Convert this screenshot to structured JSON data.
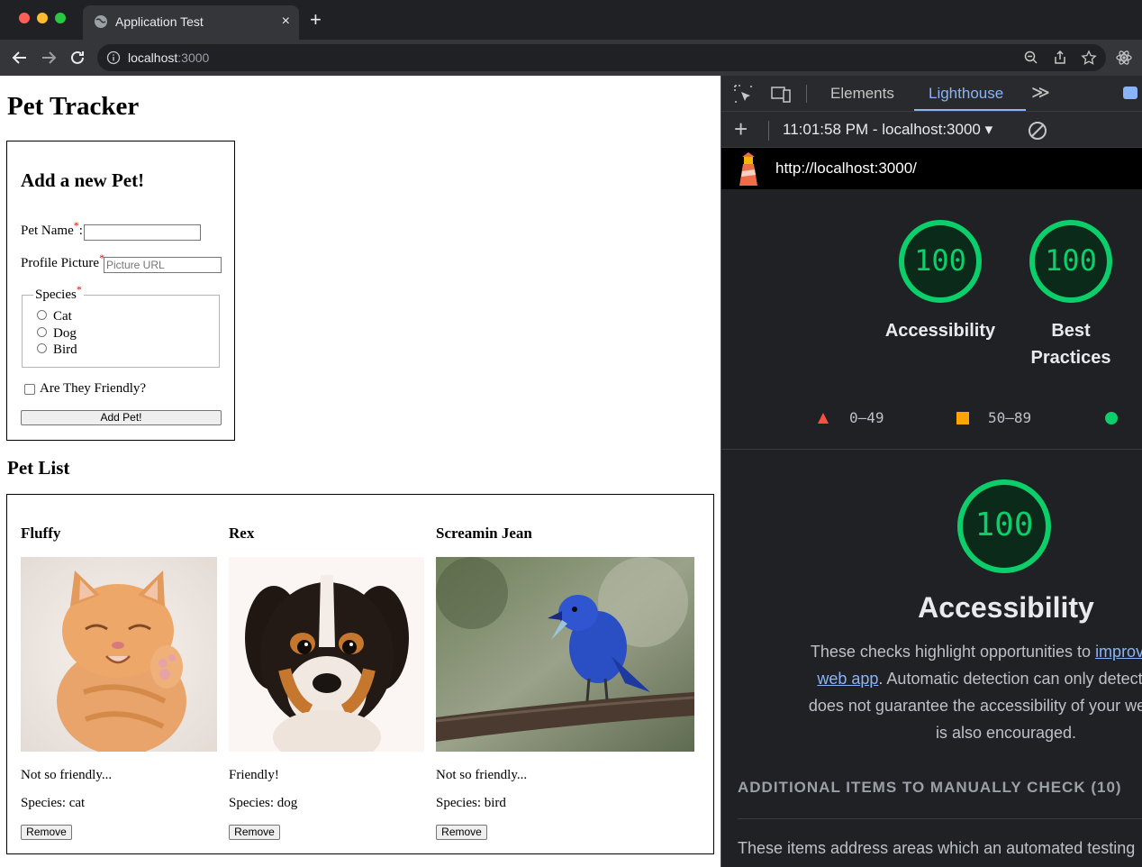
{
  "browser": {
    "tab_title": "Application Test",
    "tab_close": "×",
    "new_tab": "+",
    "url_host": "localhost",
    "url_port": ":3000"
  },
  "page": {
    "title": "Pet Tracker",
    "form": {
      "heading": "Add a new Pet!",
      "name_label": "Pet Name",
      "name_value": "",
      "profile_label": "Profile Picture",
      "profile_placeholder": "Picture URL",
      "required_mark": "*",
      "colon": ":",
      "species_legend": "Species",
      "species_options": [
        "Cat",
        "Dog",
        "Bird"
      ],
      "friendly_label": "Are They Friendly?",
      "submit_label": "Add Pet!"
    },
    "list_heading": "Pet List",
    "pets": [
      {
        "name": "Fluffy",
        "friendly": "Not so friendly...",
        "species": "Species: cat",
        "remove": "Remove"
      },
      {
        "name": "Rex",
        "friendly": "Friendly!",
        "species": "Species: dog",
        "remove": "Remove"
      },
      {
        "name": "Screamin Jean",
        "friendly": "Not so friendly...",
        "species": "Species: bird",
        "remove": "Remove"
      }
    ]
  },
  "devtools": {
    "tabs": [
      "Elements",
      "Lighthouse"
    ],
    "active_tab": "Lighthouse",
    "more": "≫",
    "report_label": "11:01:58 PM - localhost:3000 ▾",
    "url": "http://localhost:3000/",
    "scores": [
      {
        "label": "Accessibility",
        "value": "100"
      },
      {
        "label_line1": "Best",
        "label_line2": "Practices",
        "value": "100"
      }
    ],
    "legend": {
      "low": "0–49",
      "mid": "50–89"
    },
    "section": {
      "score": "100",
      "title": "Accessibility",
      "desc_before": "These checks highlight opportunities to ",
      "link_text": "improve the ac",
      "link_text_line2": "web app",
      "desc_after": ". Automatic detection can only detect a subs",
      "desc_line3": "does not guarantee the accessibility of your web app, s",
      "desc_line4": "is also encouraged.",
      "manual_heading": "ADDITIONAL ITEMS TO MANUALLY CHECK (10)",
      "manual_desc": "These items address areas which an automated testing"
    },
    "colors": {
      "pass": "#0cce6b",
      "average": "#ffa400",
      "fail": "#ff4e42"
    }
  }
}
